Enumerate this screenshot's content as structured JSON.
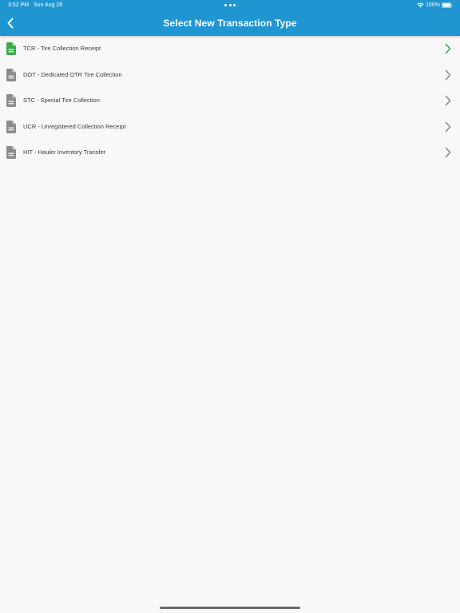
{
  "status_bar": {
    "time": "3:52 PM",
    "date": "Sun Aug 28",
    "battery": "100%"
  },
  "header": {
    "title": "Select New Transaction Type",
    "back_icon": "chevron-left-icon"
  },
  "colors": {
    "header_bg": "#1f95d2",
    "active_icon": "#3daa4a",
    "inactive_icon": "#8c8c8c"
  },
  "transaction_types": [
    {
      "label": "TCR - Tire Collection Receipt",
      "icon": "document-icon",
      "active": true
    },
    {
      "label": "DOT - Dedicated OTR Tire Collection",
      "icon": "document-icon",
      "active": false
    },
    {
      "label": "STC - Special Tire Collection",
      "icon": "document-icon",
      "active": false
    },
    {
      "label": "UCR - Unregistered Collection Receipt",
      "icon": "document-icon",
      "active": false
    },
    {
      "label": "HIT - Hauler Inventory Transfer",
      "icon": "document-icon",
      "active": false
    }
  ]
}
